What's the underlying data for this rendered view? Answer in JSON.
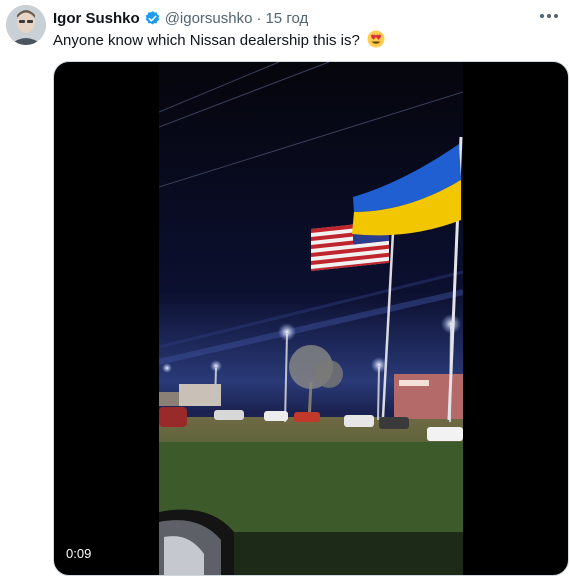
{
  "author": {
    "name": "Igor Sushko",
    "handle": "@igorsushko",
    "time": "15 год"
  },
  "tweet": {
    "text": "Anyone know which Nissan dealership this is?",
    "emoji": "smiling-face-with-heart-eyes"
  },
  "media": {
    "type": "video",
    "duration": "0:09"
  },
  "icons": {
    "verified": "verified-badge-icon",
    "more": "more-options-icon"
  },
  "colors": {
    "verified_blue": "#1d9bf0",
    "text_primary": "#0f1419",
    "text_secondary": "#536471"
  }
}
